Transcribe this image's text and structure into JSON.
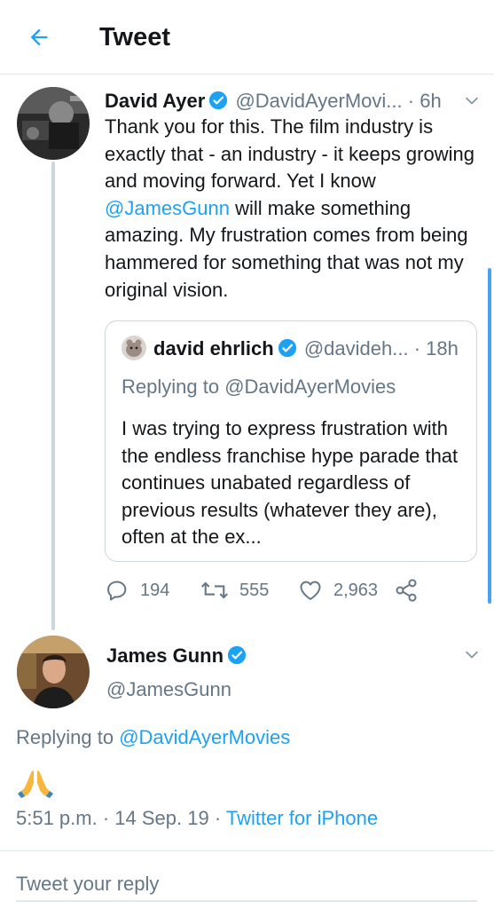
{
  "header": {
    "title": "Tweet"
  },
  "tweet": {
    "author_name": "David Ayer",
    "author_handle": "@DavidAyerMovi...",
    "separator": "·",
    "time": "6h",
    "body_1": "Thank you for this. The film industry is exactly that - an industry - it keeps growing and moving forward. Yet I know ",
    "mention": "@JamesGunn",
    "body_2": " will make something amazing. My frustration comes from being hammered for something that was not my original vision.",
    "quoted": {
      "author_name": "david ehrlich",
      "author_handle": "@davideh...",
      "separator": "·",
      "time": "18h",
      "replying_prefix": "Replying to ",
      "replying_handle": "@DavidAyerMovies",
      "body": "I was trying to express frustration with the endless franchise hype parade that continues unabated regardless of previous results (whatever they are), often at the ex..."
    },
    "actions": {
      "replies": "194",
      "retweets": "555",
      "likes": "2,963"
    }
  },
  "reply": {
    "author_name": "James Gunn",
    "author_handle": "@JamesGunn",
    "replying_prefix": "Replying to ",
    "replying_handle": "@DavidAyerMovies",
    "emoji": "🙏",
    "time": "5:51 p.m.",
    "separator": "·",
    "date": "14 Sep. 19",
    "separator2": "·",
    "source": "Twitter for iPhone"
  },
  "composer": {
    "placeholder": "Tweet your reply"
  },
  "colors": {
    "accent": "#1da1f2",
    "secondary_text": "#657786",
    "border": "#ccd6dd"
  },
  "icons": [
    "back-arrow-icon",
    "verified-icon",
    "chevron-down-icon",
    "reply-icon",
    "retweet-icon",
    "like-icon",
    "share-icon"
  ]
}
